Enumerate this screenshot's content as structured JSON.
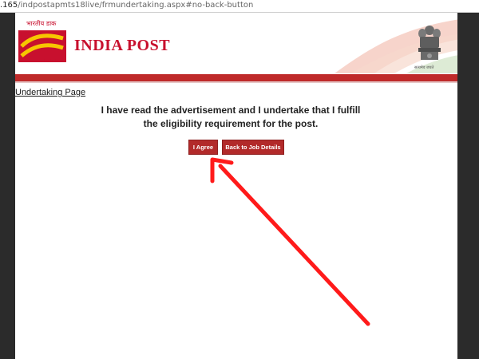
{
  "browser": {
    "url_host": ".165",
    "url_path": "/indpostapmts18live/frmundertaking.aspx#no-back-button"
  },
  "header": {
    "logo_hindi": "भारतीय डाक",
    "logo_sub": "India Post",
    "brand": "INDIA POST",
    "emblem_text": "सत्यमेव जयते"
  },
  "main": {
    "page_link": "Undertaking Page",
    "statement_line1": "I have read the advertisement and I undertake that I fulfill",
    "statement_line2": "the eligibility requirement for the post.",
    "agree_label": "I Agree",
    "back_label": "Back to Job Details"
  },
  "colors": {
    "brand_red": "#c8102e",
    "bar_red": "#bf2a2a",
    "button_red": "#b22a2a",
    "arrow_red": "#ff1a1a"
  }
}
